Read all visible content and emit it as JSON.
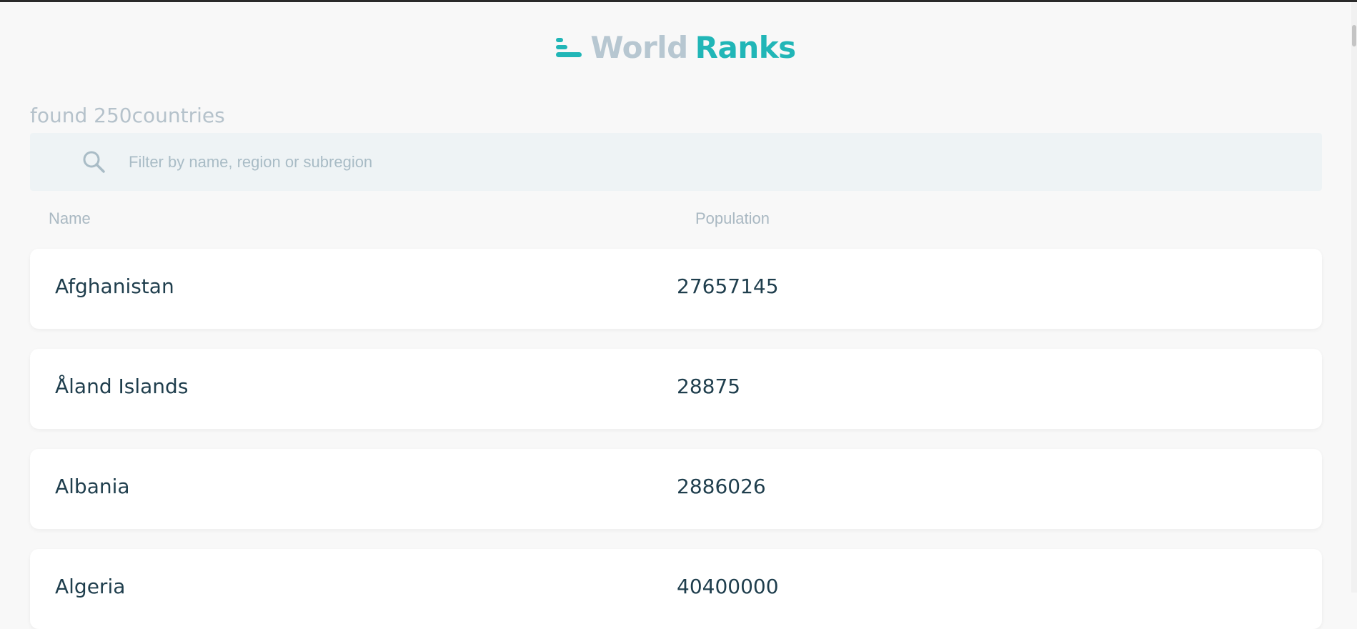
{
  "app": {
    "logo_part1": "World",
    "logo_part2": "Ranks",
    "icons": {
      "logo": "bar-rank-icon",
      "search": "search-icon"
    },
    "colors": {
      "accent": "#21b6b7",
      "muted": "#b7c7d1",
      "text": "#1f3e4d"
    }
  },
  "summary": {
    "count_text": "found 250countries"
  },
  "search": {
    "placeholder": "Filter by name, region or subregion",
    "value": ""
  },
  "table": {
    "headers": [
      "Name",
      "Population"
    ],
    "rows": [
      {
        "name": "Afghanistan",
        "population": "27657145"
      },
      {
        "name": "Åland Islands",
        "population": "28875"
      },
      {
        "name": "Albania",
        "population": "2886026"
      },
      {
        "name": "Algeria",
        "population": "40400000"
      }
    ]
  }
}
